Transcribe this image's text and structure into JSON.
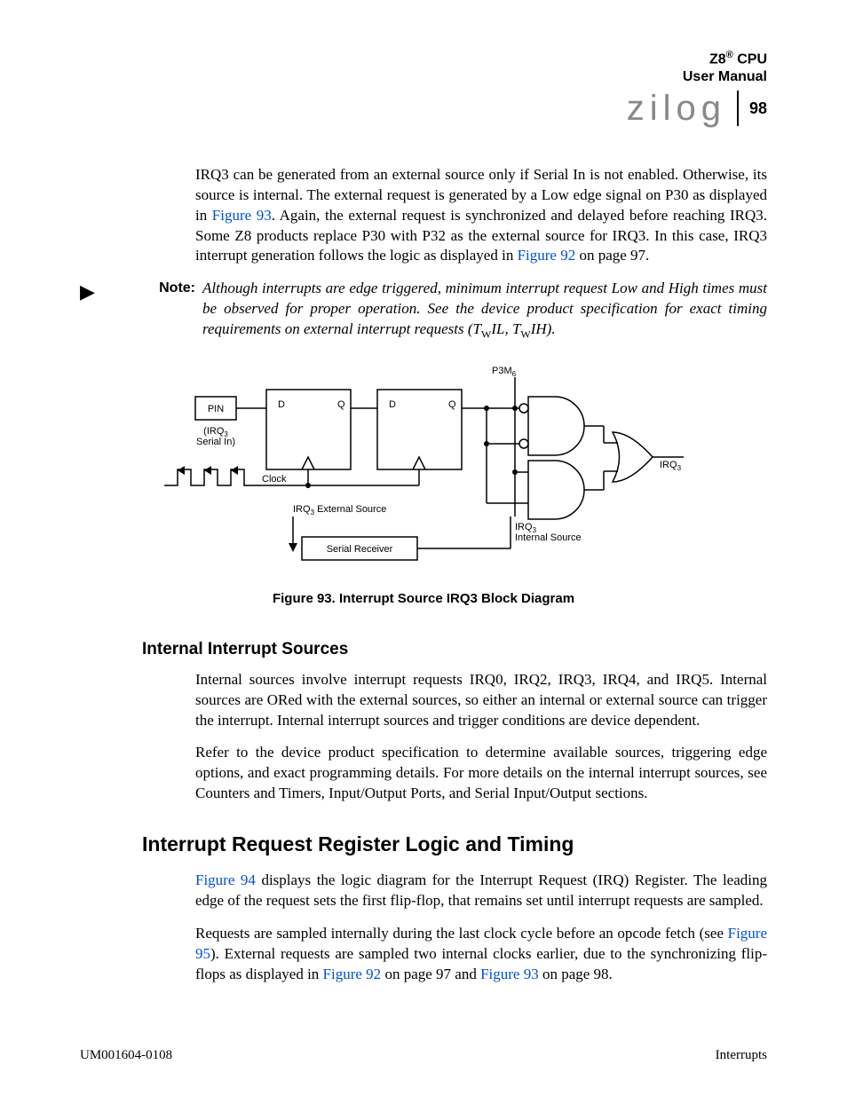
{
  "header": {
    "line1": "Z8",
    "line1_sup": "®",
    "line1_suffix": " CPU",
    "line2": "User Manual",
    "logo_text": "zilog",
    "page_number": "98"
  },
  "para1": {
    "a": "IRQ3 can be generated from an external source only if Serial In is not enabled. Otherwise, its source is internal. The external request is generated by a Low edge signal on P30 as displayed in ",
    "ref1": "Figure 93",
    "b": ". Again, the external request is synchronized and delayed before reaching IRQ3. Some Z8 products replace P30 with P32 as the external source for IRQ3. In this case, IRQ3 interrupt generation follows the logic as displayed in ",
    "ref2": "Figure 92",
    "c": " on page 97."
  },
  "note": {
    "label": "Note:",
    "a": "Although interrupts are edge triggered, minimum interrupt request Low and High times must be observed for proper operation. See the device product specification for exact timing requirements on external interrupt requests (T",
    "sub1": "W",
    "b": "IL, T",
    "sub2": "W",
    "c": "IH)."
  },
  "figure": {
    "caption": "Figure 93. Interrupt Source IRQ3 Block Diagram",
    "labels": {
      "pin": "PIN",
      "irq3_serialin_l1": "(IRQ",
      "irq3_serialin_sub": "3",
      "irq3_serialin_l2": "Serial In)",
      "clock": "Clock",
      "d1": "D",
      "q1": "Q",
      "d2": "D",
      "q2": "Q",
      "p3m6": "P3M",
      "p3m6_sub": "6",
      "ext_src": "IRQ",
      "ext_src_sub": "3",
      "ext_src_suffix": " External Source",
      "int_src": "IRQ",
      "int_src_sub": "3",
      "int_src_l2": "Internal Source",
      "serial_rx": "Serial Receiver",
      "output": "IRQ",
      "output_sub": "3"
    }
  },
  "subheading1": "Internal Interrupt Sources",
  "para2": "Internal sources involve interrupt requests IRQ0, IRQ2, IRQ3, IRQ4, and IRQ5. Internal sources are ORed with the external sources, so either an internal or external source can trigger the interrupt. Internal interrupt sources and trigger conditions are device dependent.",
  "para3": "Refer to the device product specification to determine available sources, triggering edge options, and exact programming details. For more details on the internal interrupt sources, see Counters and Timers, Input/Output Ports, and Serial Input/Output sections.",
  "heading2": "Interrupt Request Register Logic and Timing",
  "para4": {
    "ref1": "Figure 94",
    "a": " displays the logic diagram for the Interrupt Request (IRQ) Register. The leading edge of the request sets the first flip-flop, that remains set until interrupt requests are sampled."
  },
  "para5": {
    "a": "Requests are sampled internally during the last clock cycle before an opcode fetch (see ",
    "ref1": "Figure 95",
    "b": "). External requests are sampled two internal clocks earlier, due to the synchronizing flip-flops as displayed in ",
    "ref2": "Figure 92",
    "c": " on page 97 and ",
    "ref3": "Figure 93",
    "d": " on page 98."
  },
  "footer": {
    "left": "UM001604-0108",
    "right": "Interrupts"
  }
}
